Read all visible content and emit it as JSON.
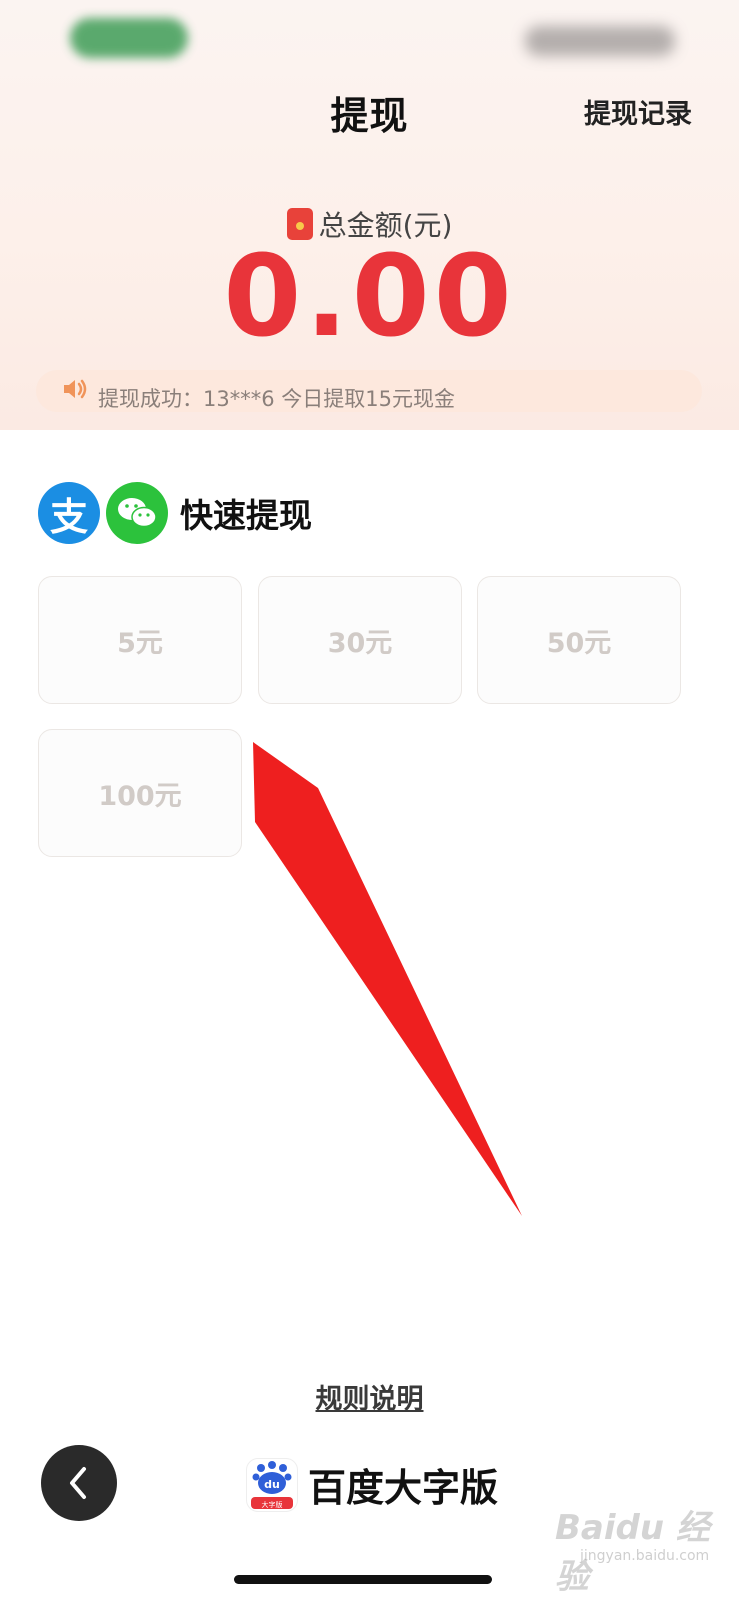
{
  "header": {
    "title": "提现",
    "record_link": "提现记录"
  },
  "balance": {
    "label": "总金额(元)",
    "amount": "0.00"
  },
  "ticker": {
    "text": "提现成功：13***6 今日提取15元现金"
  },
  "quick_withdraw": {
    "title": "快速提现",
    "alipay_glyph": "支",
    "options": [
      "5元",
      "30元",
      "50元",
      "100元"
    ]
  },
  "footer": {
    "rules_link": "规则说明",
    "brand_name": "百度大字版",
    "brand_logo_text": "du",
    "brand_logo_badge": "大字版"
  },
  "watermark": {
    "main": "Baidu 经验",
    "sub": "jingyan.baidu.com"
  },
  "colors": {
    "accent_red": "#e8343a",
    "alipay_blue": "#1b8ee3",
    "wechat_green": "#2cc23c"
  }
}
